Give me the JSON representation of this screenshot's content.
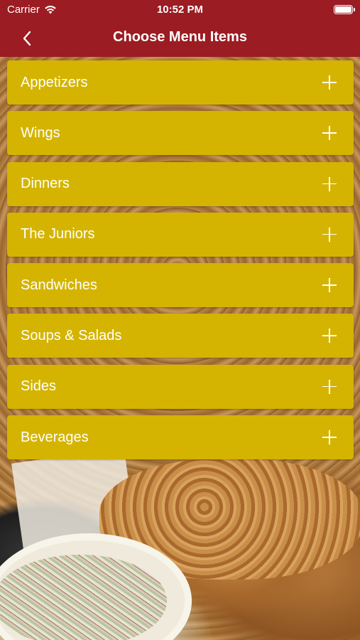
{
  "status_bar": {
    "carrier": "Carrier",
    "time": "10:52 PM",
    "wifi_icon": "wifi-icon",
    "battery_icon": "battery-icon"
  },
  "nav_bar": {
    "title": "Choose Menu Items",
    "back_icon": "chevron-left-icon",
    "background_color": "#9b1c22"
  },
  "menu": {
    "item_color": "#d4b400",
    "expand_icon": "plus-icon",
    "items": [
      {
        "label": "Appetizers"
      },
      {
        "label": "Wings"
      },
      {
        "label": "Dinners"
      },
      {
        "label": "The Juniors"
      },
      {
        "label": "Sandwiches"
      },
      {
        "label": "Soups & Salads"
      },
      {
        "label": "Sides"
      },
      {
        "label": "Beverages"
      }
    ]
  }
}
